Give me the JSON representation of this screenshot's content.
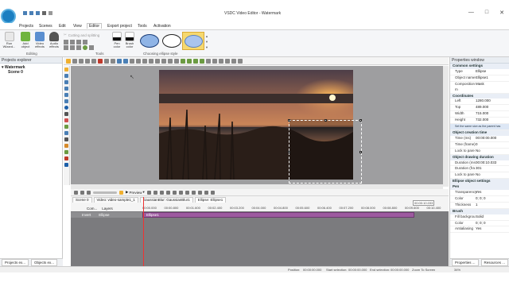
{
  "window": {
    "title": "VSDC Video Editor - Watermark"
  },
  "menu": [
    "Projects",
    "Scenes",
    "Edit",
    "View",
    "Editor",
    "Export project",
    "Tools",
    "Activation"
  ],
  "ribbon": {
    "run_wizard": "Run Wizard...",
    "add_object": "Add object",
    "video_effects": "Video effects",
    "audio_effects": "Audio effects",
    "editing_label": "Editing",
    "cutting_splitting": "Cutting and splitting",
    "tools_label": "Tools",
    "pen_color": "Pen color",
    "brush_color": "Brush color",
    "choosing_ellipse_style": "Choosing ellipse style",
    "colors": {
      "ellipse_fill_1": "#8fb4e6",
      "ellipse_fill_3": "#f6d86e",
      "ellipse_fill_3_inner": "#a9c4ee"
    }
  },
  "projects_explorer": {
    "title": "Projects explorer",
    "tree": [
      {
        "label": "Watermark"
      },
      {
        "label": "Scene 0"
      }
    ],
    "tabs": [
      "Projects ex...",
      "Objects ex..."
    ]
  },
  "properties_window": {
    "title": "Properties window",
    "rows": [
      {
        "type": "section",
        "label": "Common settings"
      },
      {
        "type": "row",
        "k": "Type",
        "v": "Ellipse"
      },
      {
        "type": "row",
        "k": "Object name",
        "v": "Ellipse1"
      },
      {
        "type": "row",
        "k": "Composition m",
        "v": "Mask"
      },
      {
        "type": "section",
        "label": "Coordinates"
      },
      {
        "type": "row",
        "k": "Left",
        "v": "1280.000"
      },
      {
        "type": "row",
        "k": "Top",
        "v": "489.000"
      },
      {
        "type": "row",
        "k": "Width",
        "v": "715.000"
      },
      {
        "type": "row",
        "k": "Height",
        "v": "732.000"
      },
      {
        "type": "link",
        "label": "Set the same size as the parent has"
      },
      {
        "type": "section",
        "label": "Object creation time"
      },
      {
        "type": "row",
        "k": "Time (ms)",
        "v": "00:00:00.000"
      },
      {
        "type": "row",
        "k": "Time (frame)",
        "v": "0"
      },
      {
        "type": "row",
        "k": "Lock to pare",
        "v": "No"
      },
      {
        "type": "section",
        "label": "Object drawing duration"
      },
      {
        "type": "row",
        "k": "Duration (ms",
        "v": "00:00:10.033"
      },
      {
        "type": "row",
        "k": "Duration (fra",
        "v": "301"
      },
      {
        "type": "row",
        "k": "Lock to pare",
        "v": "No"
      },
      {
        "type": "section",
        "label": "Ellipse object settings"
      },
      {
        "type": "section",
        "label": "Pen"
      },
      {
        "type": "row",
        "k": "Transparency",
        "v": "Yes"
      },
      {
        "type": "row",
        "k": "Color",
        "v": "0; 0; 0"
      },
      {
        "type": "row",
        "k": "Thickness",
        "v": "1"
      },
      {
        "type": "section",
        "label": "Brush"
      },
      {
        "type": "row",
        "k": "Fill backgrou",
        "v": "Solid"
      },
      {
        "type": "row",
        "k": "Color",
        "v": "0; 0; 0"
      },
      {
        "type": "row",
        "k": "Antialiasing",
        "v": "Yes"
      }
    ],
    "tabs": [
      "Properties ...",
      "Resources ..."
    ]
  },
  "timeline": {
    "preview_label": "Preview",
    "tabs": [
      "Scene 0",
      "Video: video-sample1_1",
      "GaussianBlur: GaussianBlur1",
      "Ellipse: Ellipse1"
    ],
    "layers_label": "Layers",
    "com_label": "Com...",
    "invert_label": "Invert",
    "ellipse_label": "Ellipse",
    "clip_label": "Ellipse1",
    "ruler": [
      "00:00.000",
      "00:00.800",
      "00:01.600",
      "00:02.400",
      "00:03.200",
      "00:04.000",
      "00:04.800",
      "00:05.600",
      "00:06.400",
      "00:07.200",
      "00:08.000",
      "00:08.800",
      "00:09.600",
      "00:10.400"
    ],
    "end_time": "00:00:10.033"
  },
  "status": {
    "position": "Position:",
    "position_value": "00:00:00.000",
    "start_selection": "Start selection:",
    "start_value": "00:00:00.000",
    "end_selection": "End selection:",
    "end_value": "00:00:00.000",
    "zoom": "Zoom To Screen",
    "zoom_value": "34%"
  }
}
